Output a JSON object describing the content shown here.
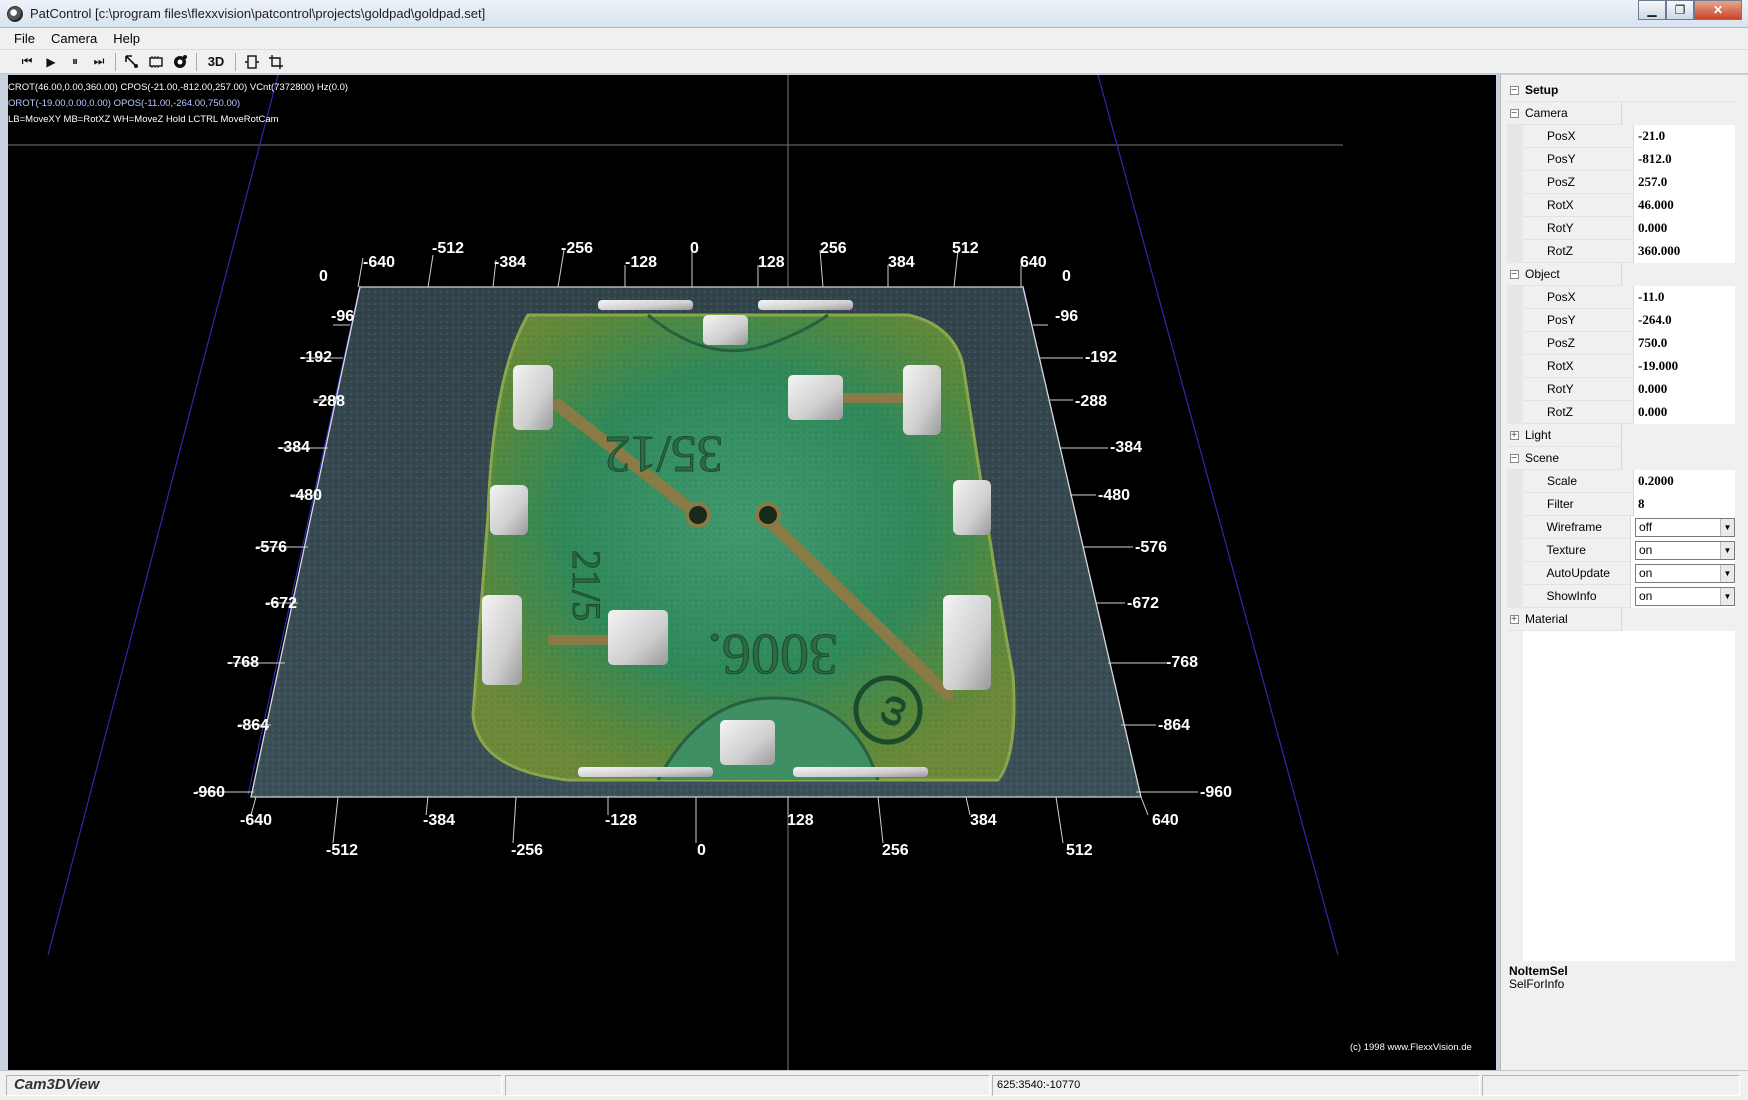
{
  "window": {
    "title": "PatControl [c:\\program files\\flexxvision\\patcontrol\\projects\\goldpad\\goldpad.set]",
    "minimize": "▁",
    "maximize": "❐",
    "close": "✕"
  },
  "menu": [
    "File",
    "Camera",
    "Help"
  ],
  "toolbar": {
    "prev": "⏮",
    "play": "▶",
    "pause": "⏸",
    "next": "⏭",
    "btn_3d": "3D"
  },
  "view": {
    "info_line1": "CROT(46.00,0.00,360.00) CPOS(-21.00,-812.00,257.00) VCnt(7372800) Hz(0.0)",
    "info_line2": "OROT(-19.00,0.00,0.00) OPOS(-11.00,-264.00,750.00)",
    "info_line3": "LB=MoveXY MB=RotXZ WH=MoveZ  Hold LCTRL MoveRotCam",
    "copyright": "(c) 1998 www.FlexxVision.de",
    "top_axis_labels": [
      "0",
      "-640",
      "-512",
      "-384",
      "-256",
      "-128",
      "0",
      "128",
      "256",
      "384",
      "512",
      "640",
      "0"
    ],
    "left_axis_labels": [
      "-96",
      "-192",
      "-288",
      "-384",
      "-480",
      "-576",
      "-672",
      "-768",
      "-864",
      "-960"
    ],
    "right_axis_labels": [
      "-96",
      "-192",
      "-288",
      "-384",
      "-480",
      "-576",
      "-672",
      "-768",
      "-864",
      "-960"
    ],
    "bottom_axis_labels": [
      "-640",
      "-512",
      "-384",
      "-256",
      "-128",
      "0",
      "128",
      "256",
      "384",
      "512",
      "640"
    ],
    "chip_text_1": "35/12",
    "chip_text_2": "3006.",
    "chip_text_3": "21/5"
  },
  "panel": {
    "setup": "Setup",
    "camera_group": "Camera",
    "camera": [
      {
        "name": "PosX",
        "value": "-21.0"
      },
      {
        "name": "PosY",
        "value": "-812.0"
      },
      {
        "name": "PosZ",
        "value": "257.0"
      },
      {
        "name": "RotX",
        "value": "46.000"
      },
      {
        "name": "RotY",
        "value": "0.000"
      },
      {
        "name": "RotZ",
        "value": "360.000"
      }
    ],
    "object_group": "Object",
    "object": [
      {
        "name": "PosX",
        "value": "-11.0"
      },
      {
        "name": "PosY",
        "value": "-264.0"
      },
      {
        "name": "PosZ",
        "value": "750.0"
      },
      {
        "name": "RotX",
        "value": "-19.000"
      },
      {
        "name": "RotY",
        "value": "0.000"
      },
      {
        "name": "RotZ",
        "value": "0.000"
      }
    ],
    "light_group": "Light",
    "scene_group": "Scene",
    "scene": [
      {
        "name": "Scale",
        "value": "0.2000"
      },
      {
        "name": "Filter",
        "value": "8"
      }
    ],
    "scene_selects": [
      {
        "name": "Wireframe",
        "value": "off"
      },
      {
        "name": "Texture",
        "value": "on"
      },
      {
        "name": "AutoUpdate",
        "value": "on"
      },
      {
        "name": "ShowInfo",
        "value": "on"
      }
    ],
    "material_group": "Material",
    "expand_minus": "−",
    "expand_plus": "+",
    "sel_title": "NoItemSel",
    "sel_desc": "SelForInfo"
  },
  "status": {
    "view_name": "Cam3DView",
    "coords": "625:3540:-10770"
  }
}
